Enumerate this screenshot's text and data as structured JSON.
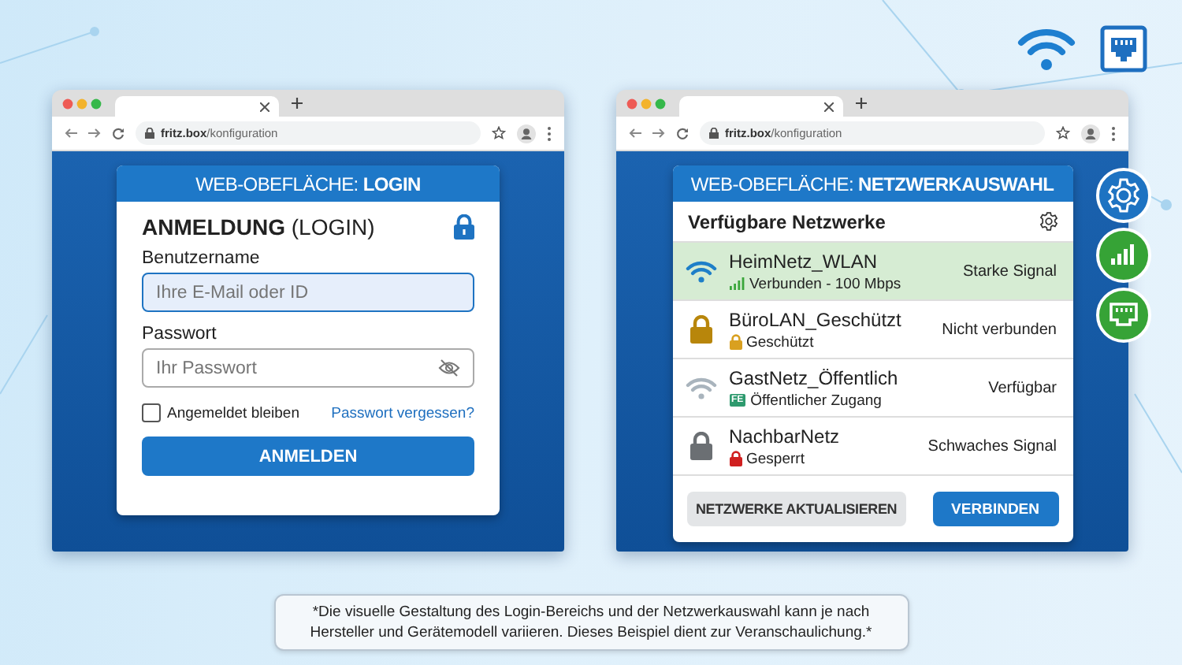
{
  "browsers": [
    {
      "url_host": "fritz.box",
      "url_path": "/konfiguration"
    },
    {
      "url_host": "fritz.box",
      "url_path": "/konfiguration"
    }
  ],
  "login": {
    "title": "WEB-OBEFLÄCHE: **LOGIN**",
    "heading": "**ANMELDUNG** (LOGIN)",
    "username": {
      "label": "Benutzername",
      "placeholder": "Ihre E-Mail oder ID",
      "focused": true
    },
    "password": {
      "label": "Passwort",
      "placeholder": "Ihr Passwort"
    },
    "remember": {
      "label": "Angemeldet bleiben",
      "checked": false
    },
    "forgot_link": "Passwort vergessen?",
    "submit": "ANMELDEN"
  },
  "network": {
    "title": "WEB-OBEFLÄCHE: **NETZWERKAUSWAHL**",
    "heading": "Verfügbare Netzwerke",
    "networks": [
      {
        "name": "HeimNetz_WLAN",
        "detail": "Verbunden - 100 Mbps",
        "signal": "Starke Signal",
        "selected": true,
        "icon": {
          "kind": "wifi",
          "color": "#1e7fc8"
        },
        "sub_icon": {
          "kind": "bars",
          "color": "#3aa63a"
        }
      },
      {
        "name": "BüroLAN_Geschützt",
        "detail": "Geschützt",
        "signal": "Nicht verbunden",
        "selected": false,
        "icon": {
          "kind": "lock",
          "color": "#b8860b"
        },
        "sub_icon": {
          "kind": "lock",
          "color": "#d9a020"
        }
      },
      {
        "name": "GastNetz_Öffentlich",
        "detail": "Öffentlicher Zugang",
        "signal": "Verfügbar",
        "selected": false,
        "icon": {
          "kind": "wifi",
          "color": "#a9b4bd"
        },
        "sub_icon": {
          "kind": "badge",
          "color": "#2e9a6e",
          "text": "FE"
        }
      },
      {
        "name": "NachbarNetz",
        "detail": "Gesperrt",
        "signal": "Schwaches Signal",
        "selected": false,
        "icon": {
          "kind": "lock",
          "color": "#6b6f73"
        },
        "sub_icon": {
          "kind": "lock",
          "color": "#d02020"
        }
      }
    ],
    "buttons": [
      {
        "label": "NETZWERKE AKTUALISIEREN",
        "kind": "secondary"
      },
      {
        "label": "VERBINDEN",
        "kind": "primary"
      }
    ]
  },
  "footnote": "*Die visuelle Gestaltung des Login-Bereichs und der Netzwerkauswahl kann je nach Hersteller und Gerätemodell variieren. Dieses Beispiel dient zur Veranschaulichung.*"
}
